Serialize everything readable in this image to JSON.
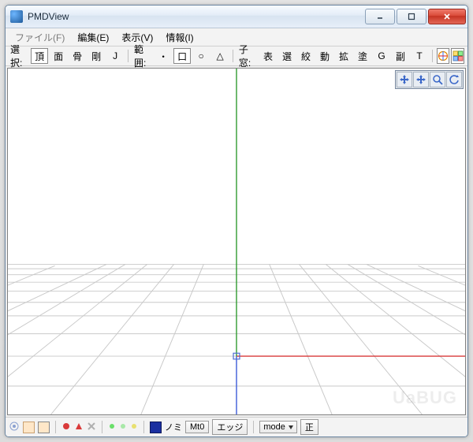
{
  "title": "PMDView",
  "menus": [
    "ファイル(F)",
    "編集(E)",
    "表示(V)",
    "情報(I)"
  ],
  "toolbar": {
    "select_label": "選択:",
    "select_buttons": [
      "頂",
      "面",
      "骨",
      "剛",
      "J"
    ],
    "range_label": "範囲:",
    "range_buttons": [
      "・",
      "口",
      "○",
      "△"
    ],
    "subwin_label": "子窓:",
    "subwin_buttons": [
      "表",
      "選",
      "絞",
      "動",
      "拡",
      "塗",
      "G",
      "副",
      "T"
    ]
  },
  "bottombar": {
    "labels": [
      "ノミ",
      "Mt0",
      "エッジ"
    ],
    "mode_label": "mode",
    "right_button": "正"
  },
  "watermark": "UaBUG"
}
